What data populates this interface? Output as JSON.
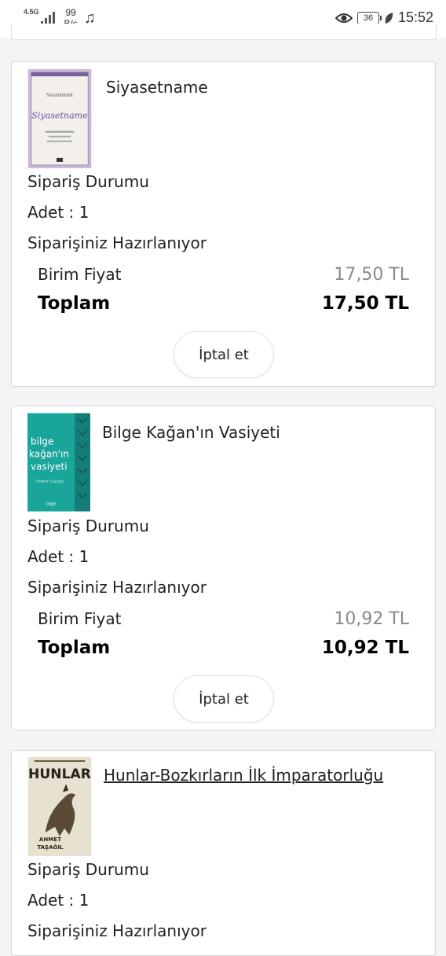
{
  "status_bar": {
    "network": "4.5G",
    "speed_value": "99",
    "speed_unit": "B/s",
    "battery": "36",
    "time": "15:52"
  },
  "orders": [
    {
      "title": "Siyasetname",
      "cover": {
        "top": "Nizamülmülk",
        "script": "Siyasetname"
      },
      "status_label": "Sipariş Durumu",
      "quantity": "Adet : 1",
      "status": "Siparişiniz Hazırlanıyor",
      "unit_price_label": "Birim Fiyat",
      "unit_price": "17,50 TL",
      "total_label": "Toplam",
      "total": "17,50 TL",
      "cancel_label": "İptal et"
    },
    {
      "title": "Bilge Kağan'ın Vasiyeti",
      "cover": {
        "l1": "bilge",
        "l2": "kağan'ın",
        "l3": "vasiyeti",
        "author": "Ahmet Taşağıl",
        "publisher": "bilge"
      },
      "status_label": "Sipariş Durumu",
      "quantity": "Adet : 1",
      "status": "Siparişiniz Hazırlanıyor",
      "unit_price_label": "Birim Fiyat",
      "unit_price": "10,92 TL",
      "total_label": "Toplam",
      "total": "10,92 TL",
      "cancel_label": "İptal et"
    },
    {
      "title": "Hunlar-Bozkırların İlk İmparatorluğu",
      "cover": {
        "title": "HUNLAR",
        "author1": "AHMET",
        "author2": "TAŞAĞIL"
      },
      "status_label": "Sipariş Durumu",
      "quantity": "Adet : 1",
      "status": "Siparişiniz Hazırlanıyor"
    }
  ]
}
